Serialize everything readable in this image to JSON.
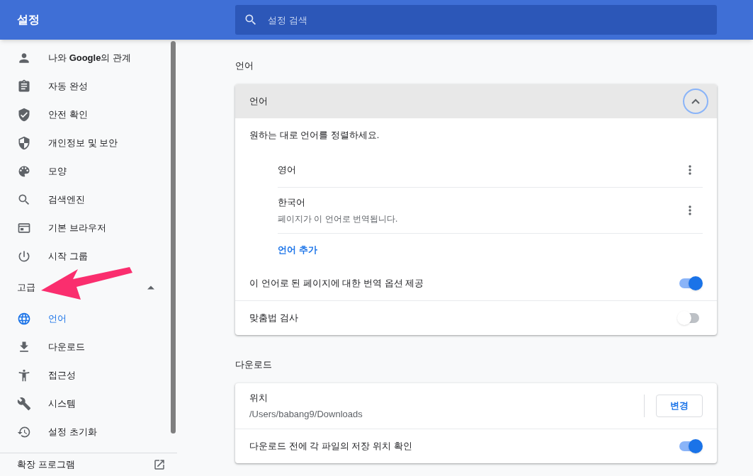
{
  "header": {
    "title": "설정",
    "search": {
      "placeholder": "설정 검색"
    }
  },
  "sidebar": {
    "items": [
      {
        "label": "나와 **Google**의 관계",
        "selected": false
      },
      {
        "label": "자동 완성",
        "selected": false
      },
      {
        "label": "안전 확인",
        "selected": false
      },
      {
        "label": "개인정보 및 보안",
        "selected": false
      },
      {
        "label": "모양",
        "selected": false
      },
      {
        "label": "검색엔진",
        "selected": false
      },
      {
        "label": "기본 브라우저",
        "selected": false
      },
      {
        "label": "시작 그룹",
        "selected": false
      }
    ],
    "advanced": {
      "label": "고급",
      "expanded": true,
      "items": [
        {
          "label": "언어",
          "selected": true
        },
        {
          "label": "다운로드",
          "selected": false
        },
        {
          "label": "접근성",
          "selected": false
        },
        {
          "label": "시스템",
          "selected": false
        },
        {
          "label": "설정 초기화",
          "selected": false
        }
      ]
    },
    "extensions": {
      "label": "확장 프로그램"
    }
  },
  "language_section": {
    "title": "언어",
    "card": {
      "header": "언어",
      "expanded": true,
      "description": "원하는 대로 언어를 정렬하세요.",
      "languages": [
        {
          "name": "영어"
        },
        {
          "name": "한국어",
          "note": "페이지가 이 언어로 번역됩니다."
        }
      ],
      "add_link": "언어 추가",
      "toggles": [
        {
          "label": "이 언어로 된 페이지에 대한 번역 옵션 제공",
          "on": true
        },
        {
          "label": "맞춤법 검사",
          "on": false
        }
      ]
    }
  },
  "download_section": {
    "title": "다운로드",
    "location": {
      "label": "위치",
      "path": "/Users/babang9/Downloads",
      "button": "변경"
    },
    "toggles": [
      {
        "label": "다운로드 전에 각 파일의 저장 위치 확인",
        "on": true
      }
    ]
  }
}
